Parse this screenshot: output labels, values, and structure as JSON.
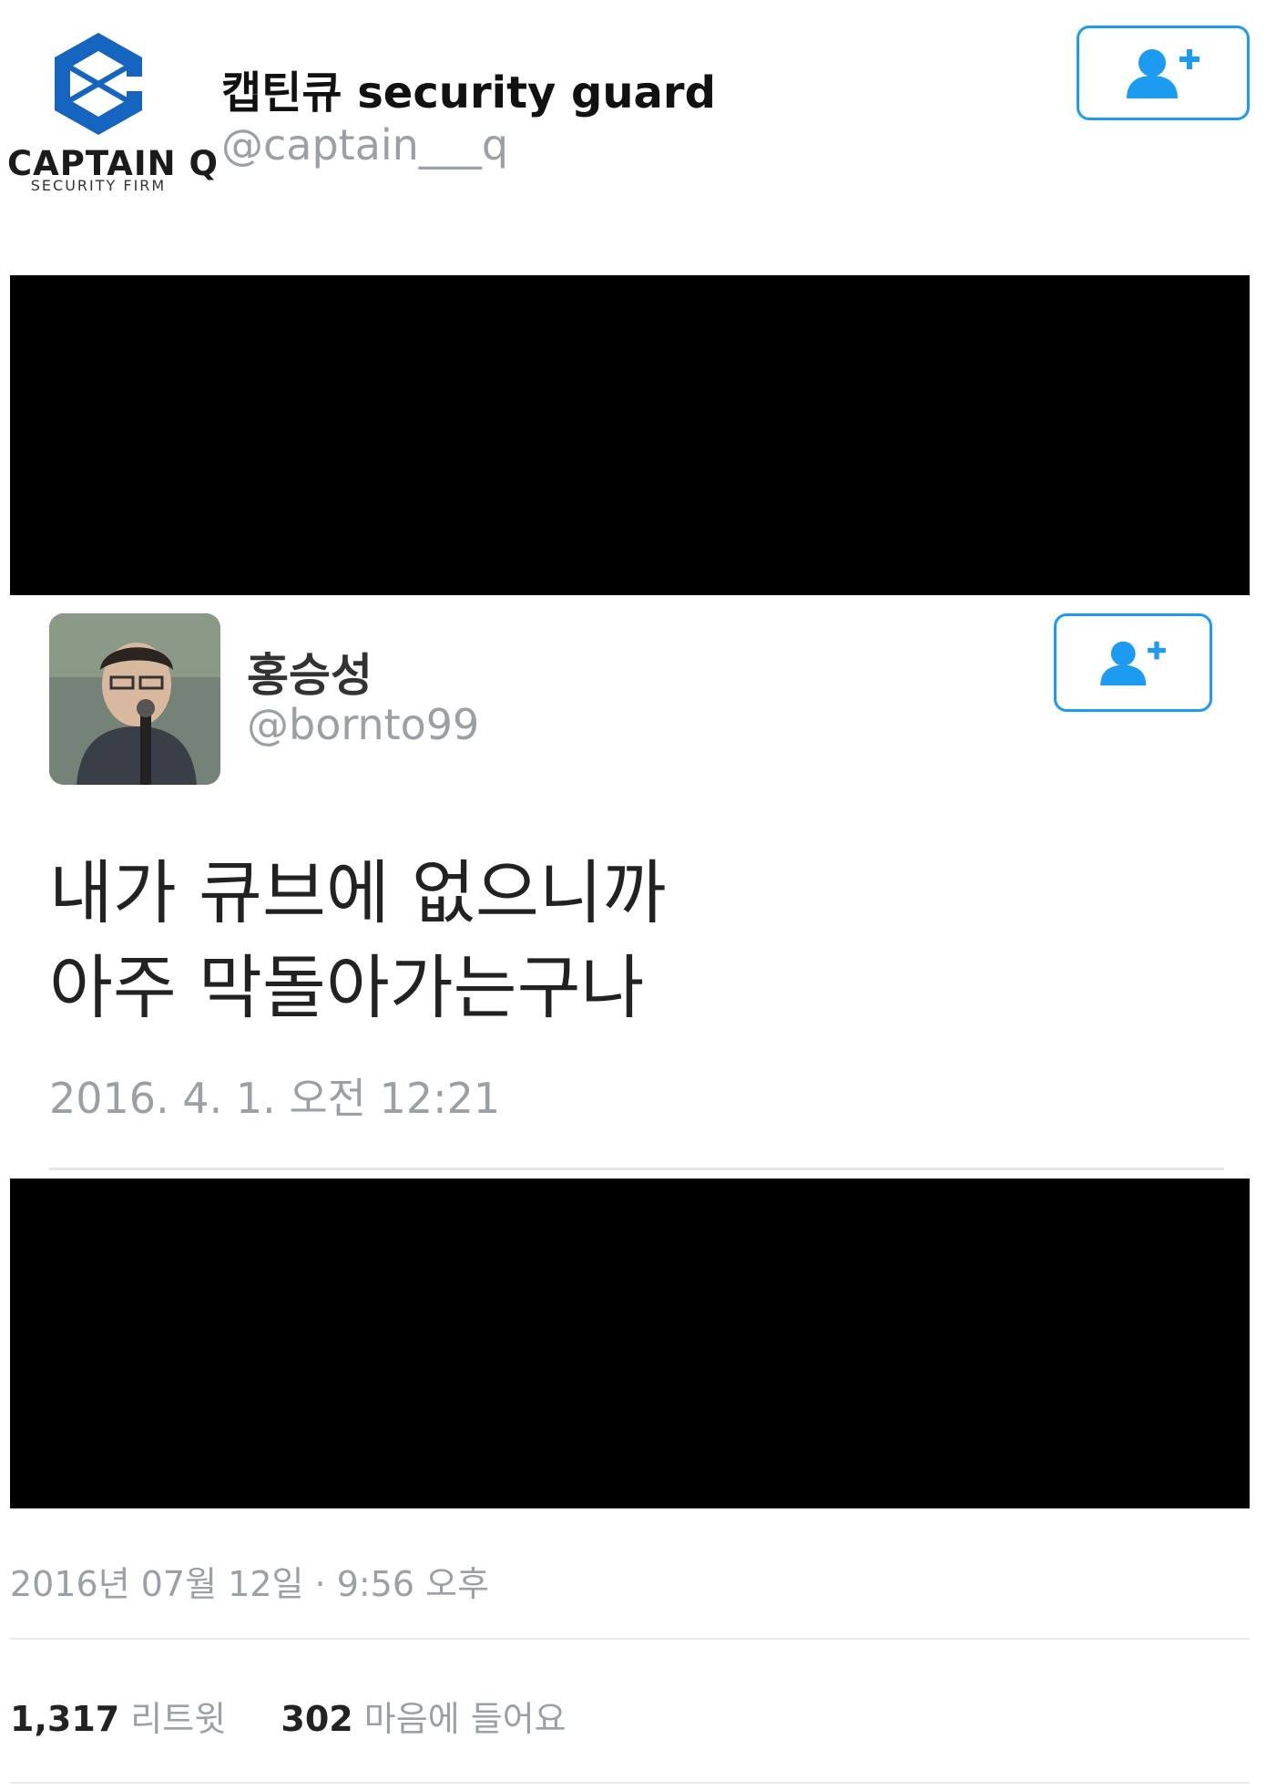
{
  "header": {
    "logo": {
      "brand": "CAPTAIN Q",
      "subtitle": "SECURITY FIRM",
      "color": "#1565c0"
    },
    "display_name": "캡틴큐 security guard",
    "handle": "@captain___q",
    "follow_icon": "add-user-icon",
    "accent_color": "#1d9bf0"
  },
  "media": {
    "embedded_tweet": {
      "display_name": "홍승성",
      "handle": "@bornto99",
      "text": "내가 큐브에 없으니까\n아주 막돌아가는구나",
      "timestamp": "2016. 4. 1. 오전 12:21",
      "follow_icon": "add-user-icon"
    }
  },
  "footer": {
    "timestamp": "2016년 07월 12일 · 9:56 오후",
    "retweet_count": "1,317",
    "retweet_label": "리트윗",
    "like_count": "302",
    "like_label": "마음에 들어요"
  }
}
